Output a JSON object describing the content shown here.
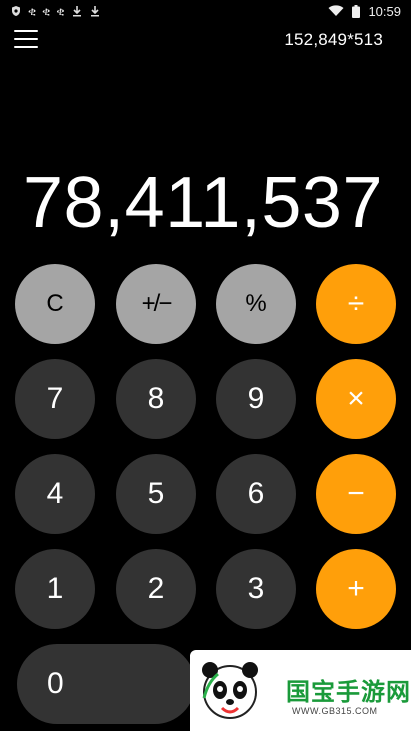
{
  "status_bar": {
    "time": "10:59",
    "left_icons": [
      "shield-icon",
      "app-icon",
      "app-icon",
      "app-icon",
      "download-icon",
      "download-icon"
    ],
    "right_icons": [
      "wifi-icon",
      "battery-icon"
    ]
  },
  "header": {
    "expression": "152,849*513"
  },
  "display": {
    "result": "78,411,537"
  },
  "keypad": {
    "clear": "C",
    "plus_minus": "+/−",
    "percent": "%",
    "divide": "÷",
    "multiply": "×",
    "minus": "−",
    "plus": "+",
    "d7": "7",
    "d8": "8",
    "d9": "9",
    "d4": "4",
    "d5": "5",
    "d6": "6",
    "d1": "1",
    "d2": "2",
    "d3": "3",
    "d0": "0"
  },
  "colors": {
    "function_key": "#a5a5a5",
    "number_key": "#333333",
    "operator_key": "#ff9f0a",
    "background": "#000000"
  },
  "watermark": {
    "title": "国宝手游网",
    "url": "WWW.GB315.COM"
  }
}
